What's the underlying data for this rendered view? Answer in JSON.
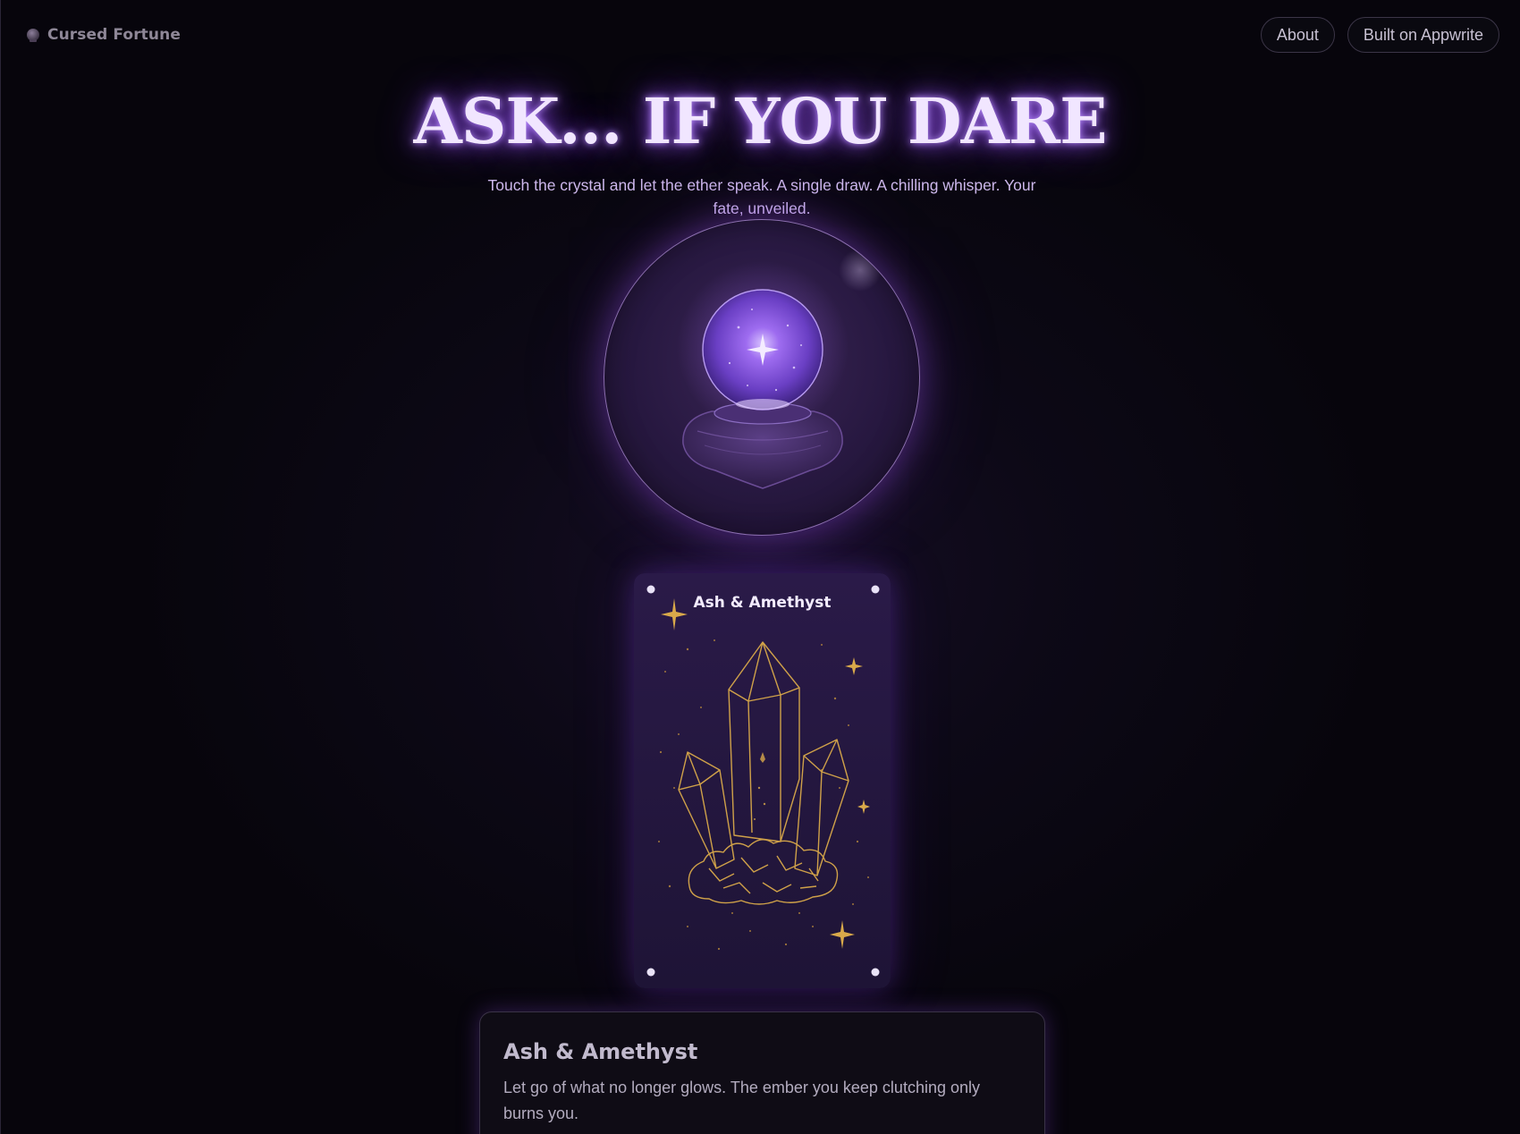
{
  "header": {
    "brand_icon": "crystal-ball-icon",
    "brand_name": "Cursed Fortune",
    "nav": {
      "about_label": "About",
      "built_label": "Built on Appwrite"
    }
  },
  "hero": {
    "title": "ASK... IF YOU DARE",
    "subtitle": "Touch the crystal and let the ether speak. A single draw. A chilling whisper. Your fate, unveiled."
  },
  "orb": {
    "icon": "crystal-ball-icon"
  },
  "card": {
    "title": "Ash & Amethyst",
    "art_icon": "amethyst-crystals-icon"
  },
  "result": {
    "title": "Ash & Amethyst",
    "text": "Let go of what no longer glows. The ember you keep clutching only burns you."
  },
  "colors": {
    "background": "#07050c",
    "accent_purple": "#8b4fe0",
    "gold_line": "#d9a94a",
    "card_bg": "#24173f"
  }
}
